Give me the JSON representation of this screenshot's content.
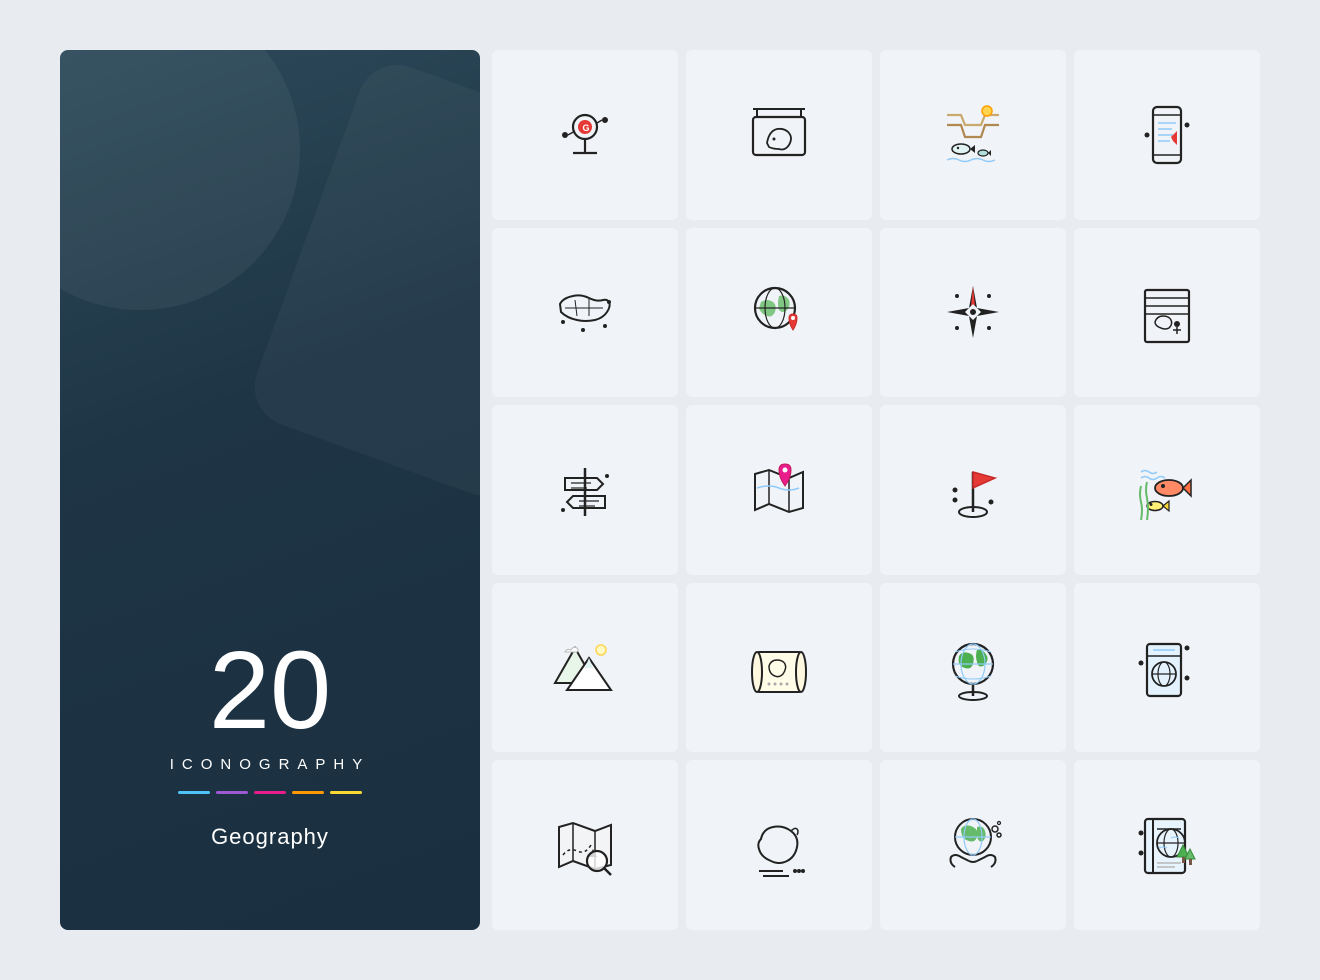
{
  "sidebar": {
    "number": "20",
    "iconography_label": "ICONOGRAPHY",
    "title": "Geography",
    "color_bars": [
      {
        "color": "#4fc3f7"
      },
      {
        "color": "#9c59d1"
      },
      {
        "color": "#e91e8c"
      },
      {
        "color": "#ff9800"
      },
      {
        "color": "#f9d835"
      }
    ]
  },
  "icons": [
    {
      "id": "location-pin",
      "label": "Location Pin with G"
    },
    {
      "id": "australia-board",
      "label": "Australia Sign Board"
    },
    {
      "id": "canyon-fish",
      "label": "Canyon with Fish"
    },
    {
      "id": "mobile-map",
      "label": "Mobile Navigation"
    },
    {
      "id": "usa-map",
      "label": "USA Map"
    },
    {
      "id": "globe-location",
      "label": "Globe with Location"
    },
    {
      "id": "compass-star",
      "label": "Compass Star"
    },
    {
      "id": "map-book",
      "label": "Map Book"
    },
    {
      "id": "signpost",
      "label": "Signpost"
    },
    {
      "id": "map-pin",
      "label": "Map with Pin"
    },
    {
      "id": "flag-stand",
      "label": "Flag on Stand"
    },
    {
      "id": "fish-underwater",
      "label": "Fish Underwater"
    },
    {
      "id": "mountains",
      "label": "Mountains"
    },
    {
      "id": "scroll-map",
      "label": "Scroll Map"
    },
    {
      "id": "globe-stand",
      "label": "Globe on Stand"
    },
    {
      "id": "passport-globe",
      "label": "Passport with Globe"
    },
    {
      "id": "map-search",
      "label": "Map with Magnifier"
    },
    {
      "id": "australia-continent",
      "label": "Australia Continent"
    },
    {
      "id": "earth-hands",
      "label": "Earth in Hands"
    },
    {
      "id": "geography-book",
      "label": "Geography Book"
    }
  ]
}
